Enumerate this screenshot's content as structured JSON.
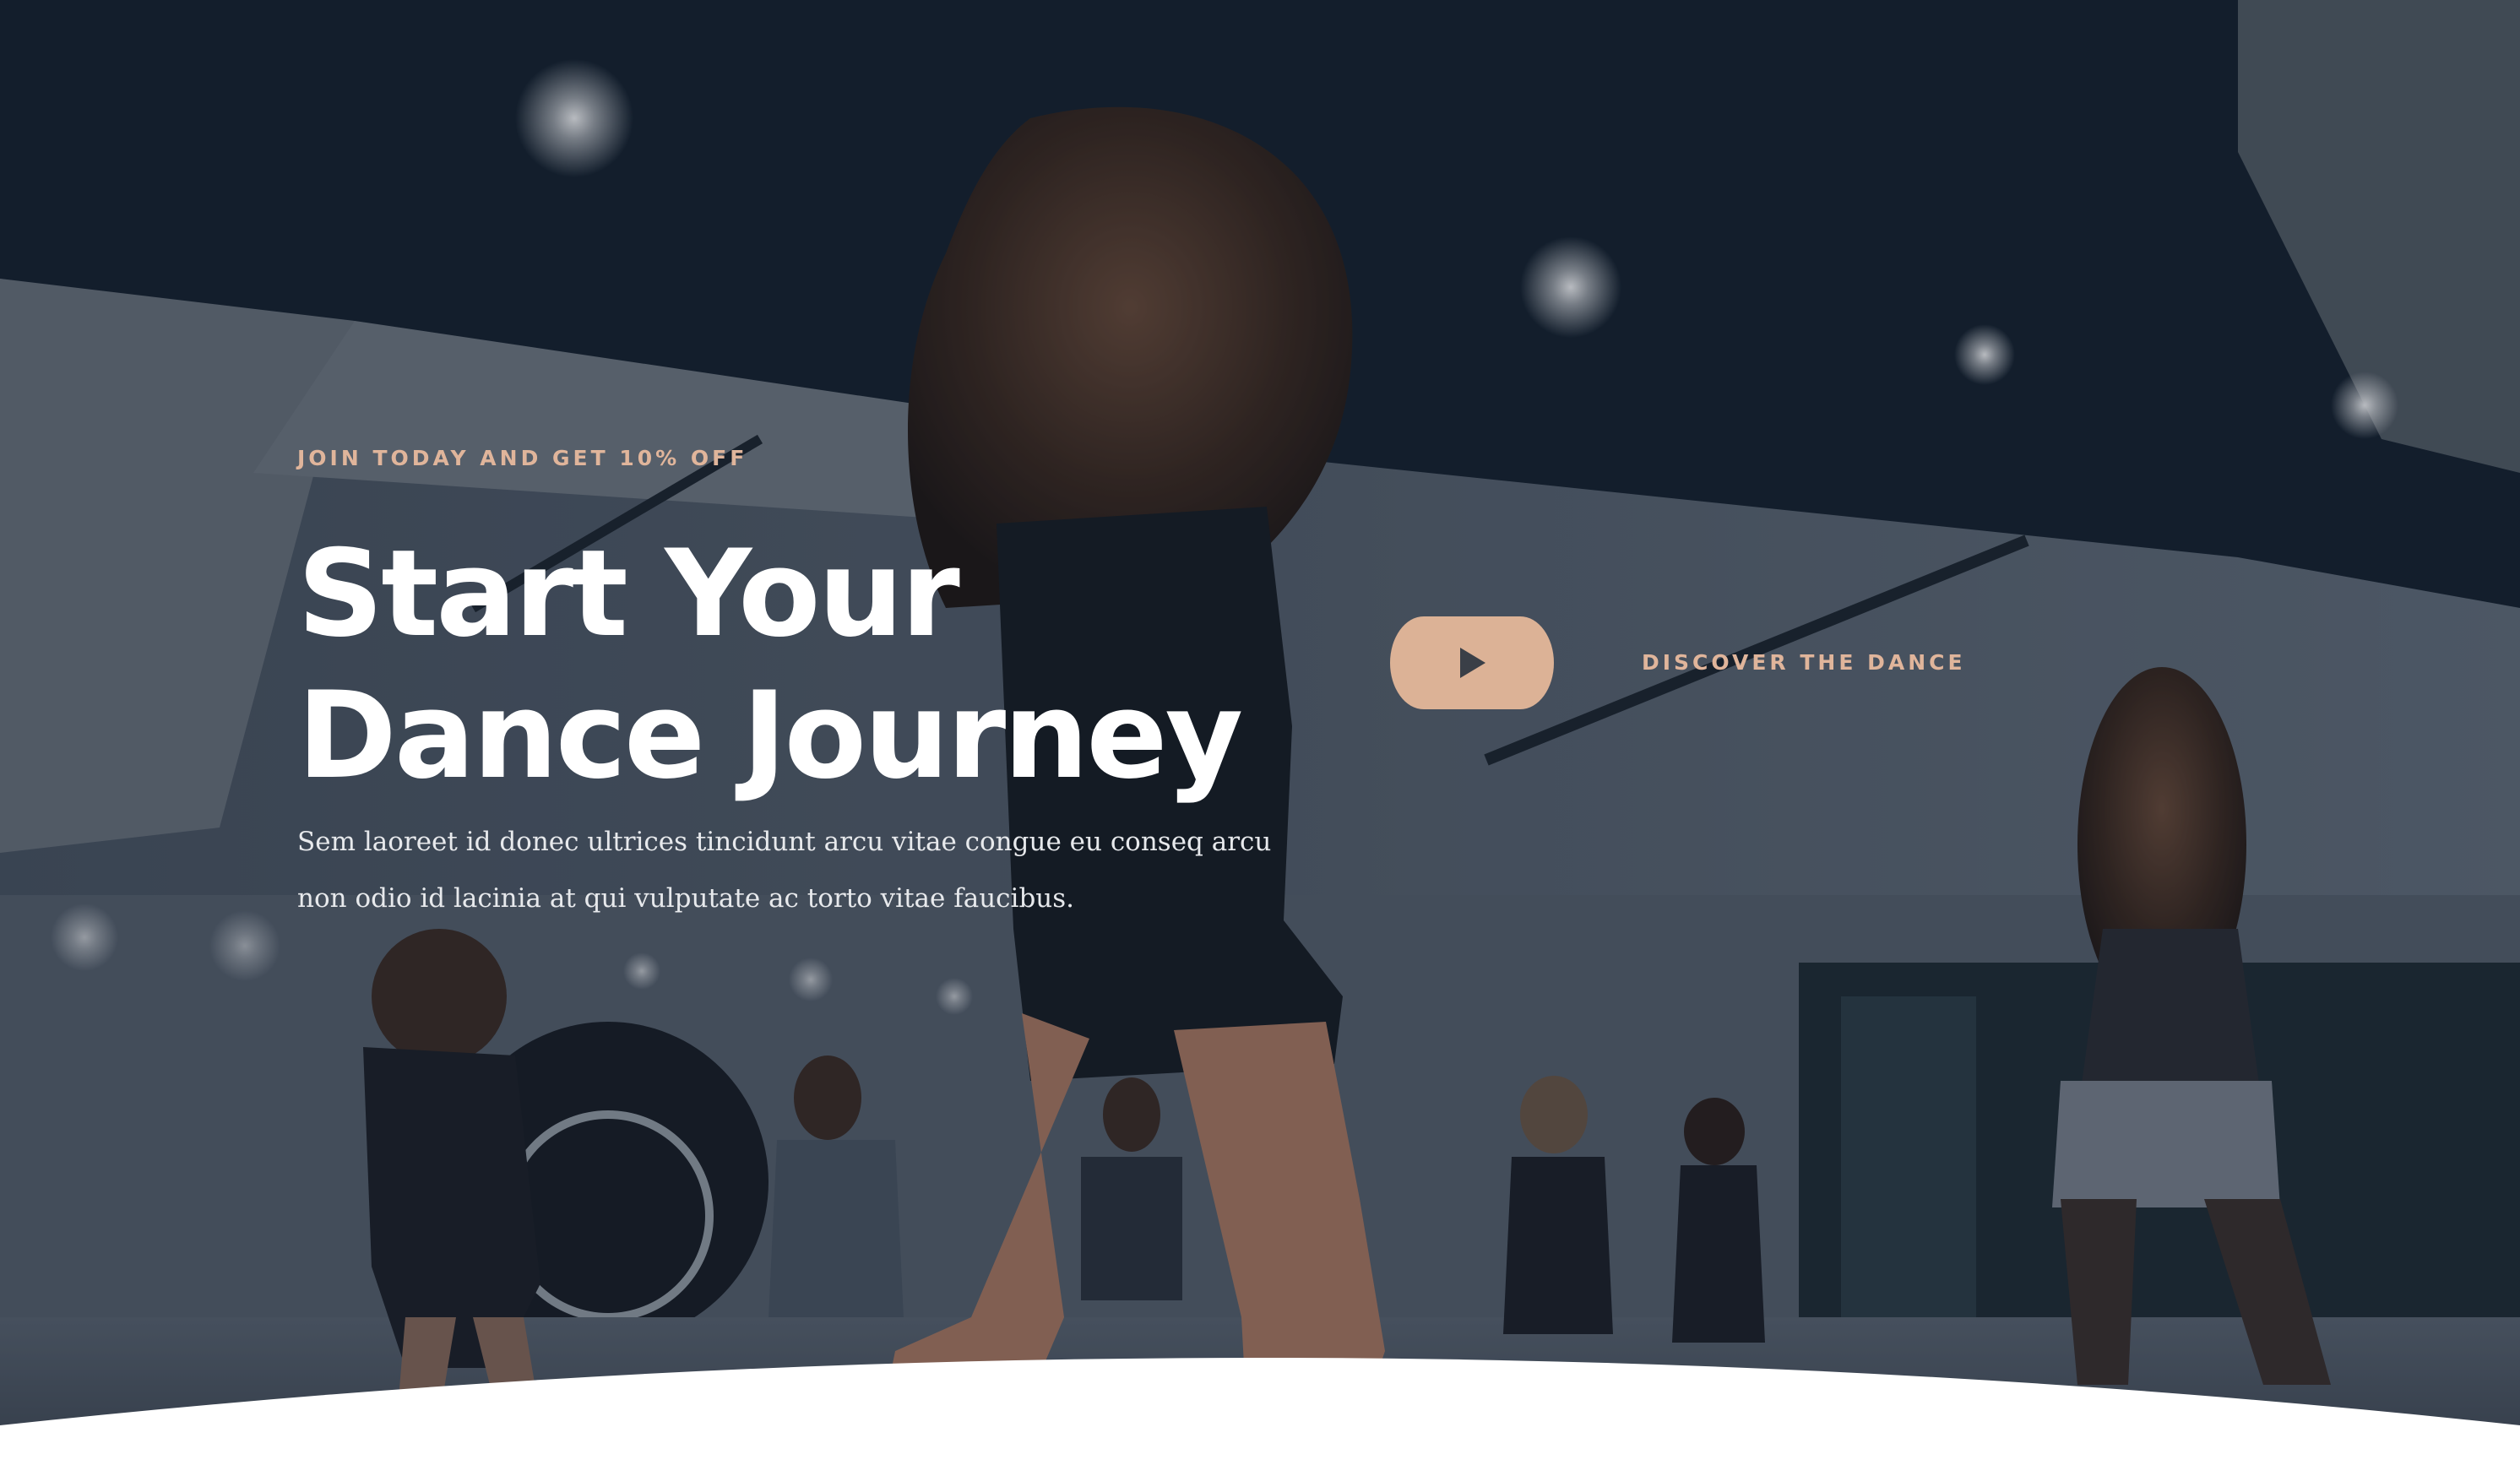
{
  "hero": {
    "eyebrow": "JOIN TODAY AND GET 10% OFF",
    "headline_line1": "Start Your",
    "headline_line2": "Dance Journey",
    "description": "Sem laoreet id donec ultrices tincidunt arcu vitae congue eu conseq arcu non odio id lacinia at qui vulputate ac torto vitae faucibus.",
    "video_cta": {
      "icon": "play-icon",
      "label": "DISCOVER THE DANCE"
    },
    "background_image": "dance-studio-photo"
  },
  "colors": {
    "accent": "#dcb296",
    "accent_text": "#e0b59b",
    "heading": "#ffffff",
    "body_text": "#e7e9ec",
    "ceiling": "#131f2c"
  }
}
